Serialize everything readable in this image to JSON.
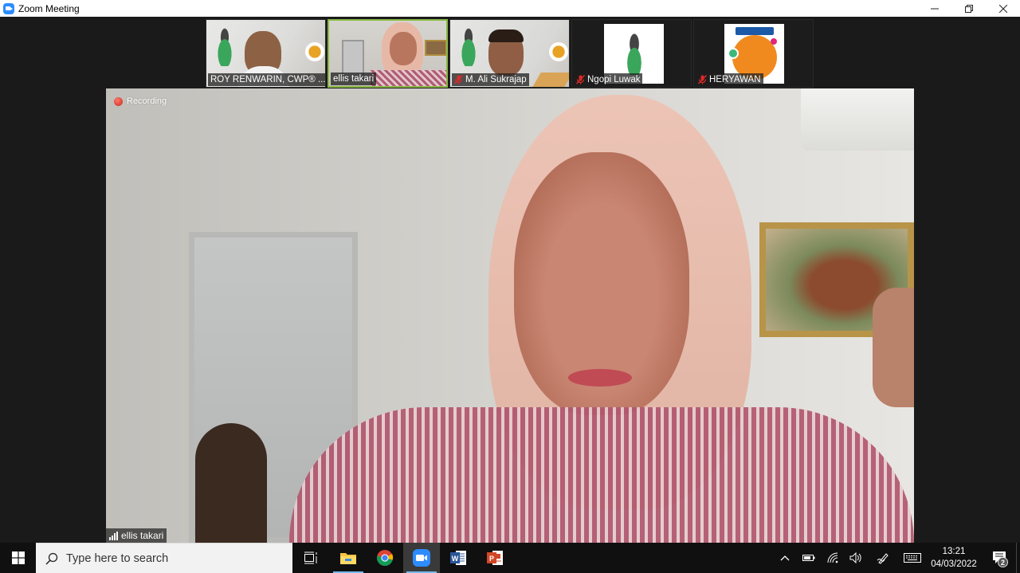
{
  "window": {
    "title": "Zoom Meeting",
    "app_icon": "zoom-icon",
    "controls": [
      {
        "name": "minimize",
        "icon": "minimize-icon"
      },
      {
        "name": "restore",
        "icon": "restore-icon"
      },
      {
        "name": "close",
        "icon": "close-icon"
      }
    ]
  },
  "gallery": {
    "participants": [
      {
        "name": "ROY RENWARIN, CWP® ...",
        "muted": false,
        "video": true,
        "active_speaker": false
      },
      {
        "name": "ellis takari",
        "muted": false,
        "video": true,
        "active_speaker": true
      },
      {
        "name": "M. Ali Sukrajap",
        "muted": true,
        "video": true,
        "active_speaker": false
      },
      {
        "name": "Ngopi Luwak",
        "muted": true,
        "video": false,
        "active_speaker": false
      },
      {
        "name": "HERYAWAN",
        "muted": true,
        "video": false,
        "active_speaker": false
      }
    ],
    "active_color": "#8ab843"
  },
  "main_video": {
    "speaker_name": "ellis takari",
    "recording_label": "Recording",
    "recording_color": "#d93025"
  },
  "taskbar": {
    "search_placeholder": "Type here to search",
    "apps": [
      {
        "name": "Task View",
        "icon": "task-view-icon"
      },
      {
        "name": "File Explorer",
        "icon": "folder-icon",
        "running": true
      },
      {
        "name": "Google Chrome",
        "icon": "chrome-icon"
      },
      {
        "name": "Zoom",
        "icon": "zoom-icon",
        "running": true,
        "active": true
      },
      {
        "name": "Microsoft Word",
        "icon": "word-icon"
      },
      {
        "name": "Microsoft PowerPoint",
        "icon": "powerpoint-icon"
      }
    ],
    "tray": {
      "icons": [
        "chevron-up-icon",
        "battery-icon",
        "wifi-icon",
        "volume-icon",
        "pen-icon",
        "keyboard-icon"
      ],
      "time": "13:21",
      "date": "04/03/2022",
      "notification_count": "2"
    }
  }
}
